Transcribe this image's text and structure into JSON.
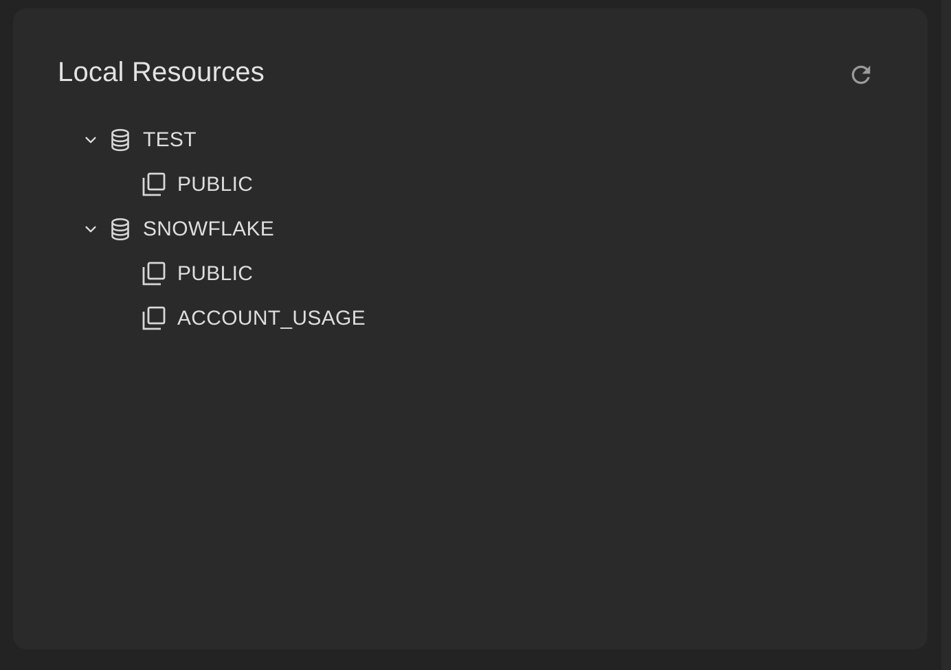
{
  "panel": {
    "title": "Local Resources",
    "refresh_icon": "refresh-icon"
  },
  "tree": {
    "databases": [
      {
        "name": "TEST",
        "expanded": true,
        "icon": "database-icon",
        "schemas": [
          {
            "name": "PUBLIC",
            "icon": "schema-icon"
          }
        ]
      },
      {
        "name": "SNOWFLAKE",
        "expanded": true,
        "icon": "database-icon",
        "schemas": [
          {
            "name": "PUBLIC",
            "icon": "schema-icon"
          },
          {
            "name": "ACCOUNT_USAGE",
            "icon": "schema-icon"
          }
        ]
      }
    ]
  },
  "colors": {
    "background": "#232323",
    "panel": "#2a2a2a",
    "text": "#dedede",
    "icon": "#d8d8d8",
    "refresh": "#9a9a9a"
  }
}
